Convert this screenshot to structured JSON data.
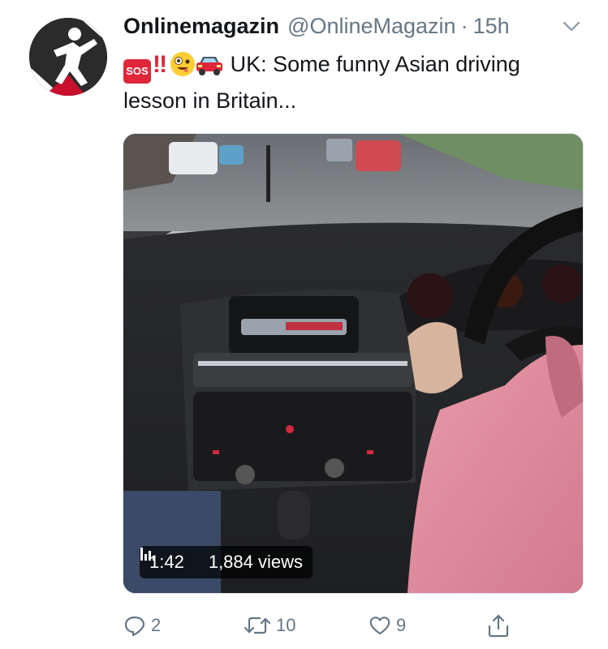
{
  "tweet": {
    "display_name": "Onlinemagazin",
    "handle": "@OnlineMagazin",
    "separator": "·",
    "time": "15h",
    "emoji": {
      "sos": "SOS",
      "bang": "‼",
      "face_name": "zany-face-emoji",
      "car_name": "car-emoji"
    },
    "text": "UK: Some funny Asian driving lesson in Britain...",
    "video": {
      "duration": "1:42",
      "views": "1,884 views"
    },
    "actions": {
      "replies": "2",
      "retweets": "10",
      "likes": "9"
    }
  },
  "colors": {
    "text_primary": "#14171a",
    "text_secondary": "#657786",
    "border": "#e1e8ed",
    "sos_red": "#e0263b"
  }
}
